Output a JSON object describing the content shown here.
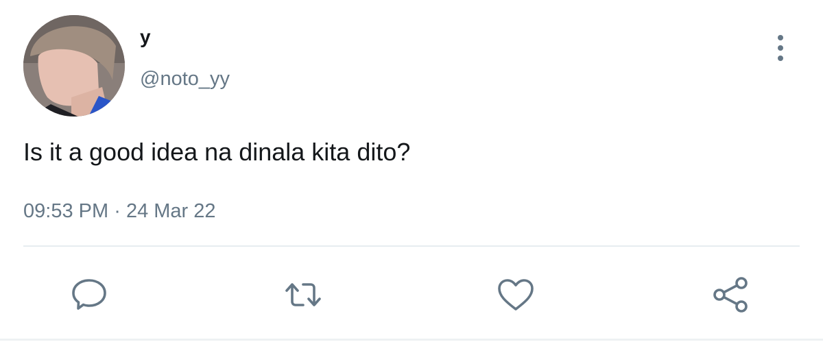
{
  "tweet": {
    "display_name": "y",
    "handle": "@noto_yy",
    "text": "Is it a good idea na dinala kita dito?",
    "time": "09:53 PM",
    "separator": "·",
    "date": "24 Mar 22",
    "more_icon": "more-vertical-icon"
  },
  "actions": [
    {
      "name": "reply",
      "icon": "comment-icon"
    },
    {
      "name": "retweet",
      "icon": "retweet-icon"
    },
    {
      "name": "like",
      "icon": "heart-icon"
    },
    {
      "name": "share",
      "icon": "share-icon"
    }
  ],
  "colors": {
    "text": "#14171a",
    "secondary": "#657786",
    "divider": "#e6ecf0"
  }
}
